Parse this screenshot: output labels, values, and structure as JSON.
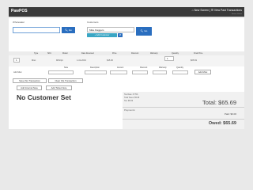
{
  "app": {
    "brand": "PawPOS",
    "nav_right": "⌂ New Screen | ☰ View Past Transactions",
    "nav_sub": "← Return Home"
  },
  "wholesaler": {
    "label": "Wholesaler",
    "value": "",
    "go_label": "Go"
  },
  "customer": {
    "label": "Customers",
    "value": "Mike Daggers",
    "go_label": "Go",
    "add_label": "+ Add Customer",
    "clear_icon": "ban-icon"
  },
  "table": {
    "headers": [
      "Type",
      "SKU",
      "Model",
      "Date Received",
      "Price",
      "Discount",
      "Warranty",
      "Quantity",
      "Final Price"
    ],
    "headers2": [
      "Note",
      "Description",
      "Amount",
      "Discount",
      "Warranty",
      "Quantity"
    ],
    "row": {
      "qty_left": "1",
      "type": "Misc",
      "model": "MISOpt",
      "date": "1-31-2019",
      "price": "$15.00",
      "quantity": "1",
      "final": "$65.69"
    },
    "add_misc_label": "Add Misc",
    "add_misc_button": "Add Misc"
  },
  "actions": {
    "save": "Save this Transaction",
    "clear": "Clear this Transaction",
    "internal_note": "Add Internal Note",
    "ticket_note": "Add Ticket Note"
  },
  "customer_status": "No Customer Set",
  "summary": {
    "line1": "Tax Rate: 8.75%",
    "line2": "Total Taxes: $5.69",
    "line3": "Tax: $5.69",
    "total": "Total: $65.69",
    "payments_label": "Payments:",
    "paid": "Paid: $0.00",
    "owed": "Owed: $65.69"
  }
}
